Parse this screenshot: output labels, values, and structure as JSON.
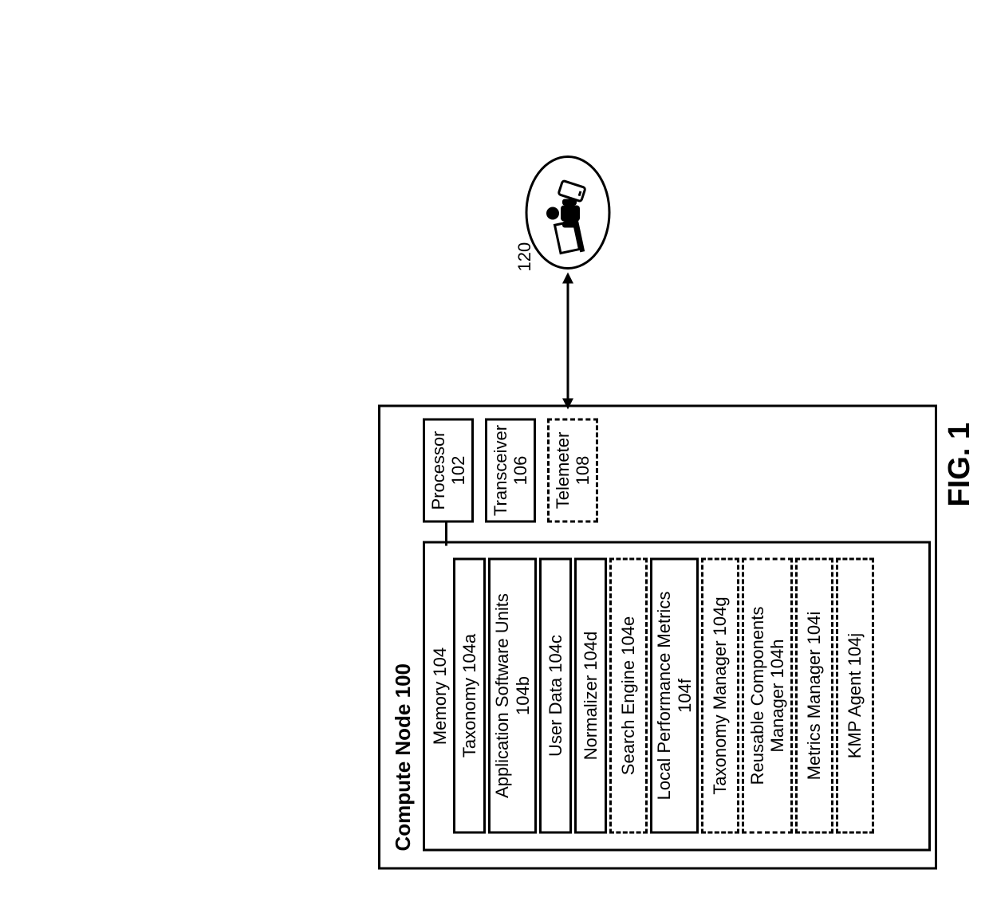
{
  "figure": {
    "caption": "FIG. 1"
  },
  "compute_node": {
    "title": "Compute Node 100",
    "memory": {
      "label": "Memory 104",
      "items": {
        "taxonomy": {
          "label": "Taxonomy 104a",
          "dashed": false
        },
        "appsw": {
          "label": "Application Software Units\n104b",
          "dashed": false
        },
        "userdata": {
          "label": "User Data 104c",
          "dashed": false
        },
        "normalizer": {
          "label": "Normalizer 104d",
          "dashed": false
        },
        "search": {
          "label": "Search Engine 104e",
          "dashed": true
        },
        "localperf": {
          "label": "Local Performance Metrics\n104f",
          "dashed": false
        },
        "taxmgr": {
          "label": "Taxonomy Manager 104g",
          "dashed": true
        },
        "reuse": {
          "label": "Reusable Components\nManager 104h",
          "dashed": true
        },
        "metricsmgr": {
          "label": "Metrics Manager 104i",
          "dashed": true
        },
        "kmp": {
          "label": "KMP Agent 104j",
          "dashed": true
        }
      }
    },
    "side": {
      "processor": {
        "label": "Processor\n102",
        "dashed": false
      },
      "transceiver": {
        "label": "Transceiver\n106",
        "dashed": false
      },
      "telemeter": {
        "label": "Telemeter\n108",
        "dashed": true
      }
    }
  },
  "external": {
    "user_ref": "120"
  }
}
